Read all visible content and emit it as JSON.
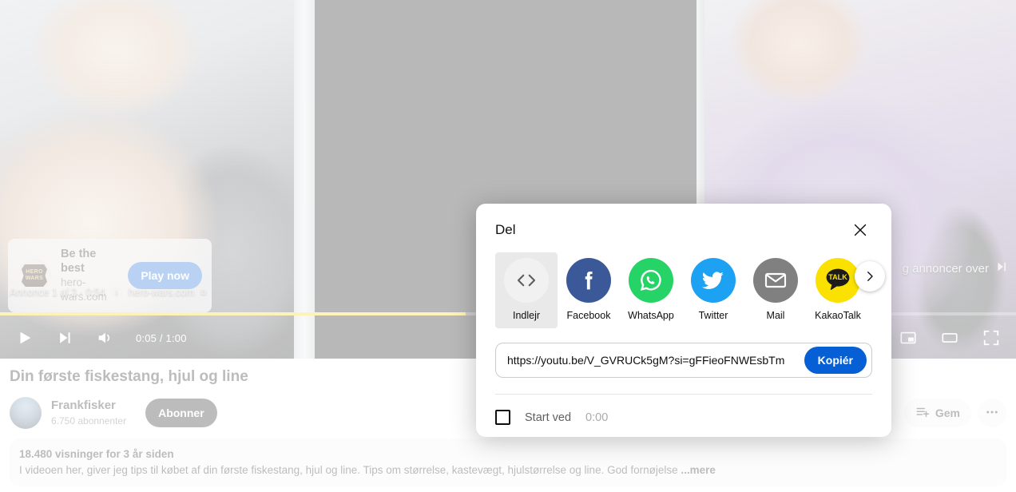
{
  "player": {
    "ad": {
      "title": "Be the best",
      "domain": "hero-wars.com",
      "cta_label": "Play now",
      "logo_line1": "HERO",
      "logo_line2": "WARS",
      "meta_text": "Annonce 1 af 2 · 0:54",
      "info_icon": "info-icon",
      "meta_domain": "hero-wars.com",
      "external_icon": "external-link-icon",
      "skip_text": "g annoncer over",
      "skip_icon": "skip-next-icon"
    },
    "controls": {
      "play_icon": "play-icon",
      "next_icon": "next-video-icon",
      "volume_icon": "volume-icon",
      "time": "0:05 / 1:00",
      "miniplayer_icon": "miniplayer-icon",
      "theater_icon": "theater-mode-icon",
      "fullscreen_icon": "fullscreen-icon"
    },
    "progress_percent": 45.8,
    "progress_color": "#ffd000"
  },
  "video": {
    "title": "Din første fiskestang, hjul og line",
    "channel": "Frankfisker",
    "subscribers": "6.750 abonnenter",
    "subscribe_label": "Abonner",
    "save_label": "Gem",
    "save_icon": "save-to-playlist-icon",
    "more_icon": "more-options-icon",
    "stats": "18.480 visninger  for 3 år siden",
    "description": "I videoen her, giver jeg tips til købet af din første fiskestang, hjul og line. Tips om størrelse, kastevægt, hjulstørrelse og line. God fornøjelse",
    "more_label": "...mere"
  },
  "dialog": {
    "title": "Del",
    "close_icon": "close-icon",
    "next_icon": "chevron-right-icon",
    "share_targets": [
      {
        "label": "Indlejr",
        "icon": "embed-code-icon",
        "color": "#f1f1f1",
        "active": true
      },
      {
        "label": "Facebook",
        "icon": "facebook-icon",
        "color": "#3b5998",
        "active": false
      },
      {
        "label": "WhatsApp",
        "icon": "whatsapp-icon",
        "color": "#25d366",
        "active": false
      },
      {
        "label": "Twitter",
        "icon": "twitter-icon",
        "color": "#1da1f2",
        "active": false
      },
      {
        "label": "Mail",
        "icon": "mail-icon",
        "color": "#808080",
        "active": false
      },
      {
        "label": "KakaoTalk",
        "icon": "kakaotalk-icon",
        "color": "#fae100",
        "active": false
      }
    ],
    "share_url": "https://youtu.be/V_GVRUCk5gM?si=gFFieoFNWEsbTm",
    "copy_label": "Kopiér",
    "copy_color": "#065fd4",
    "start_at_label": "Start ved",
    "start_at_time": "0:00",
    "start_at_checked": false
  }
}
